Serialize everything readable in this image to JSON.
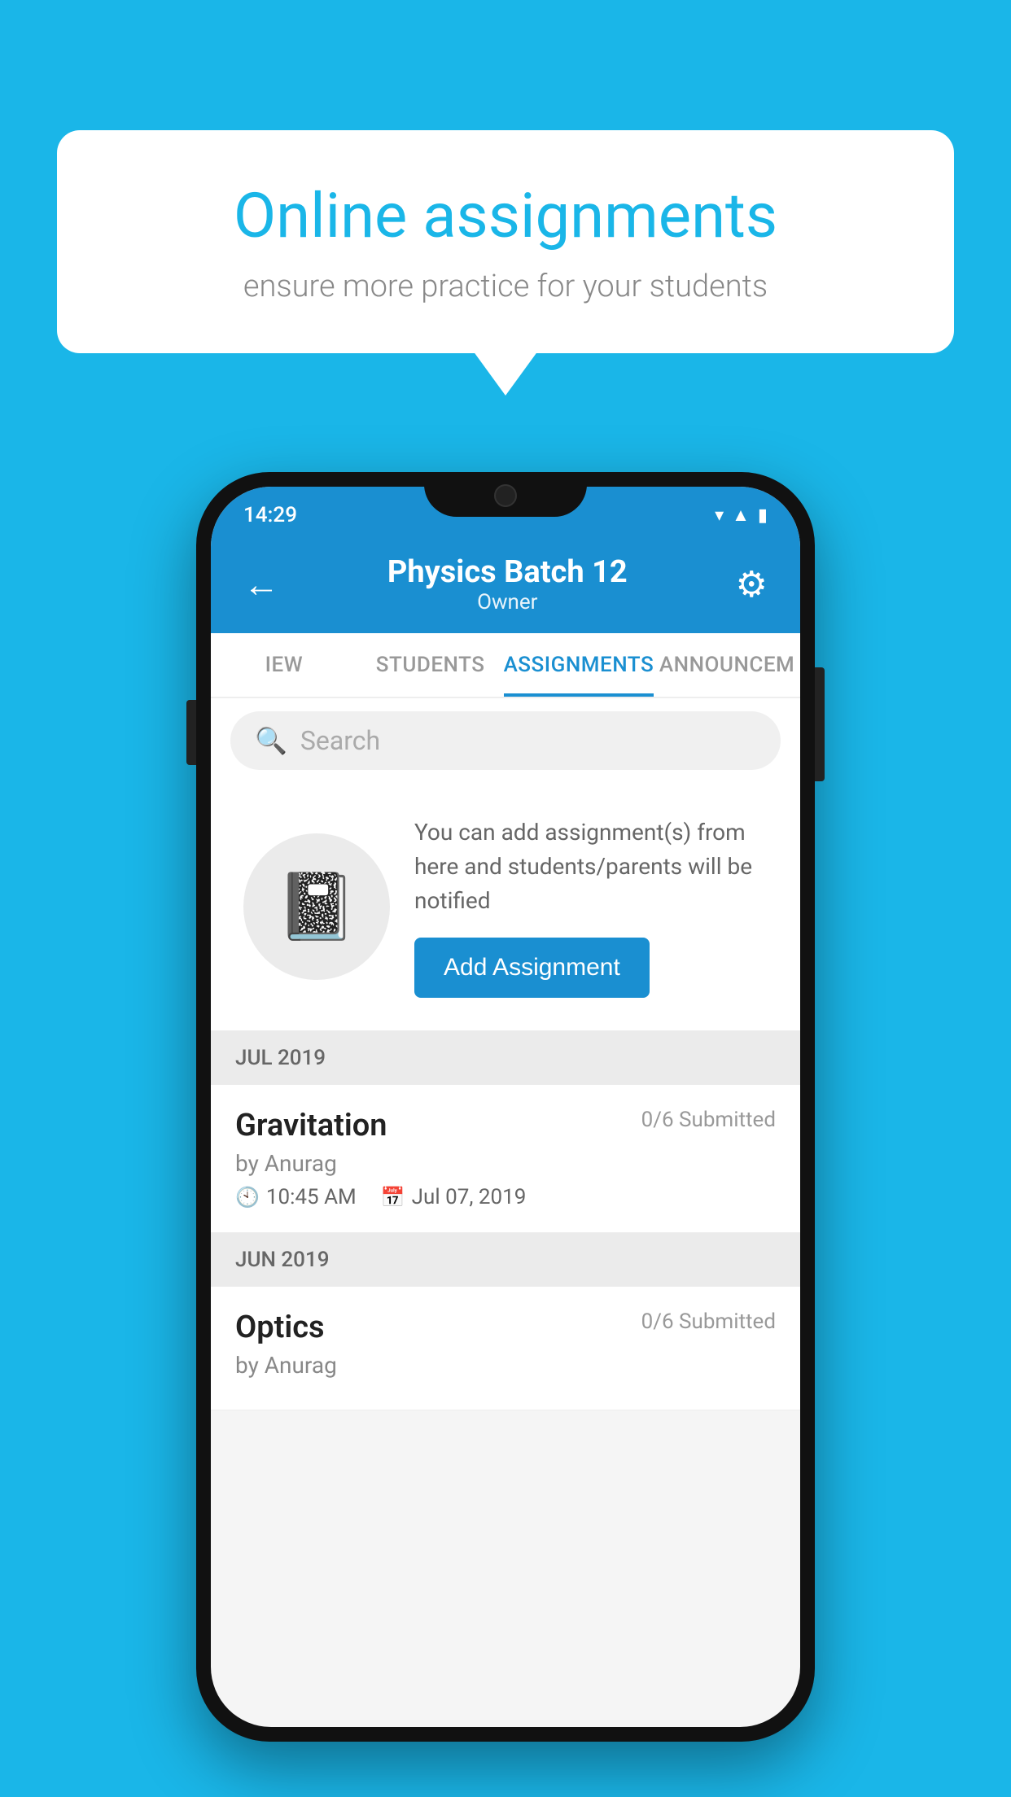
{
  "background": {
    "color": "#1ab6e8"
  },
  "speech_bubble": {
    "title": "Online assignments",
    "subtitle": "ensure more practice for your students"
  },
  "status_bar": {
    "time": "14:29",
    "wifi": "▾",
    "signal": "▲",
    "battery": "▮"
  },
  "header": {
    "title": "Physics Batch 12",
    "subtitle": "Owner",
    "back_label": "←",
    "gear_label": "⚙"
  },
  "tabs": [
    {
      "label": "IEW",
      "active": false
    },
    {
      "label": "STUDENTS",
      "active": false
    },
    {
      "label": "ASSIGNMENTS",
      "active": true
    },
    {
      "label": "ANNOUNCEM",
      "active": false
    }
  ],
  "search": {
    "placeholder": "Search"
  },
  "empty_state": {
    "description": "You can add assignment(s) from here and students/parents will be notified",
    "button_label": "Add Assignment"
  },
  "sections": [
    {
      "header": "JUL 2019",
      "assignments": [
        {
          "name": "Gravitation",
          "submitted": "0/6 Submitted",
          "by": "by Anurag",
          "time": "10:45 AM",
          "date": "Jul 07, 2019"
        }
      ]
    },
    {
      "header": "JUN 2019",
      "assignments": [
        {
          "name": "Optics",
          "submitted": "0/6 Submitted",
          "by": "by Anurag",
          "time": "",
          "date": ""
        }
      ]
    }
  ]
}
